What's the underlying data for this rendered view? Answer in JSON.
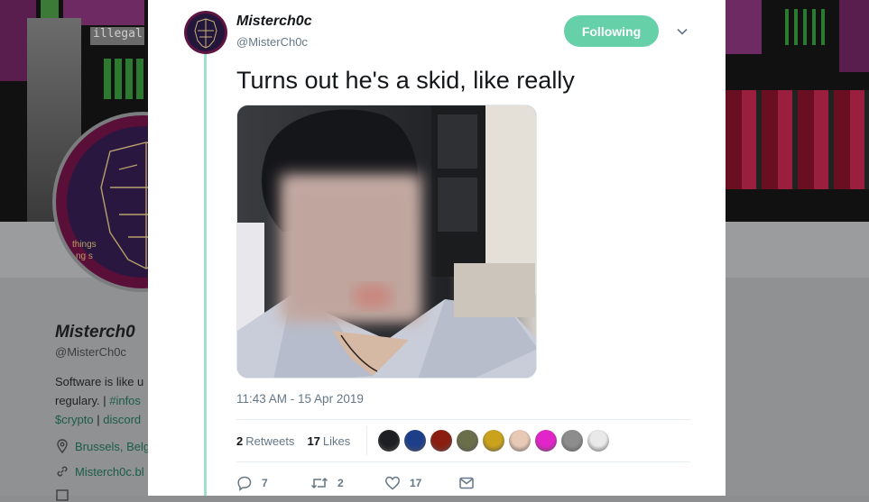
{
  "background_profile": {
    "banner_text": "illegal",
    "avatar_text_1": "things",
    "avatar_text_2": "ng s",
    "name": "Misterch0",
    "handle": "@MisterCh0c",
    "bio_line1": "Software is like u",
    "bio_line2_prefix": "regulary. | ",
    "bio_line2_link": "#infos",
    "bio_line3_link1": "$crypto",
    "bio_line3_sep": " | ",
    "bio_line3_link2": "discord",
    "location": "Brussels, Belg",
    "website": "Misterch0c.bl"
  },
  "tweet": {
    "display_name": "Misterch0c",
    "handle": "@MisterCh0c",
    "follow_label": "Following",
    "text": "Turns out he's a skid, like really",
    "timestamp": "11:43 AM - 15 Apr 2019",
    "retweets_count": "2",
    "retweets_label": "Retweets",
    "likes_count": "17",
    "likes_label": "Likes",
    "reply_count": "7",
    "retweet_count": "2",
    "like_count": "17"
  },
  "likers": [
    {
      "icon": "liker-avatar-dark-hood",
      "color": "#1e1f22"
    },
    {
      "icon": "liker-avatar-blue-planet",
      "color": "#1d3f8a"
    },
    {
      "icon": "liker-avatar-red-fire",
      "color": "#8a1e10"
    },
    {
      "icon": "liker-avatar-face",
      "color": "#6b6e4a"
    },
    {
      "icon": "liker-avatar-yellow-mask",
      "color": "#caa21c"
    },
    {
      "icon": "liker-avatar-cartoon",
      "color": "#e8c9b5"
    },
    {
      "icon": "liker-avatar-pink-blob",
      "color": "#e225c8"
    },
    {
      "icon": "liker-avatar-grey-face",
      "color": "#8d8d8d"
    },
    {
      "icon": "liker-avatar-white-mask",
      "color": "#e9e9e9"
    }
  ],
  "colors": {
    "accent": "#66d0a8",
    "thread_line": "#9fe0cf",
    "link": "#1a5c46"
  }
}
